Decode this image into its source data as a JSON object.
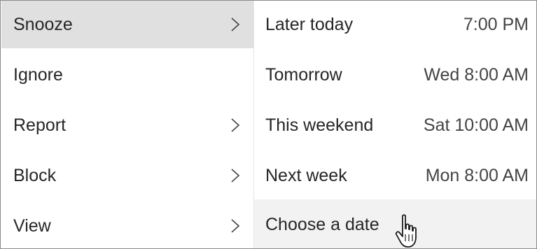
{
  "main_menu": {
    "items": [
      {
        "label": "Snooze",
        "has_submenu": true,
        "state": "selected",
        "icon": "chevron-right-icon"
      },
      {
        "label": "Ignore",
        "has_submenu": false,
        "state": "normal"
      },
      {
        "label": "Report",
        "has_submenu": true,
        "state": "normal",
        "icon": "chevron-right-icon"
      },
      {
        "label": "Block",
        "has_submenu": true,
        "state": "normal",
        "icon": "chevron-right-icon"
      },
      {
        "label": "View",
        "has_submenu": true,
        "state": "normal",
        "icon": "chevron-right-icon"
      }
    ]
  },
  "snooze_menu": {
    "items": [
      {
        "label": "Later today",
        "time": "7:00 PM"
      },
      {
        "label": "Tomorrow",
        "time": "Wed 8:00 AM"
      },
      {
        "label": "This weekend",
        "time": "Sat 10:00 AM"
      },
      {
        "label": "Next week",
        "time": "Mon 8:00 AM"
      },
      {
        "label": "Choose a date",
        "time": "",
        "state": "hovered"
      }
    ]
  },
  "colors": {
    "selected_bg": "#e0e0e0",
    "hover_bg": "#f2f2f2",
    "text": "#262626",
    "border": "#8a8a8a"
  },
  "cursor": {
    "icon": "hand-pointer-icon"
  }
}
